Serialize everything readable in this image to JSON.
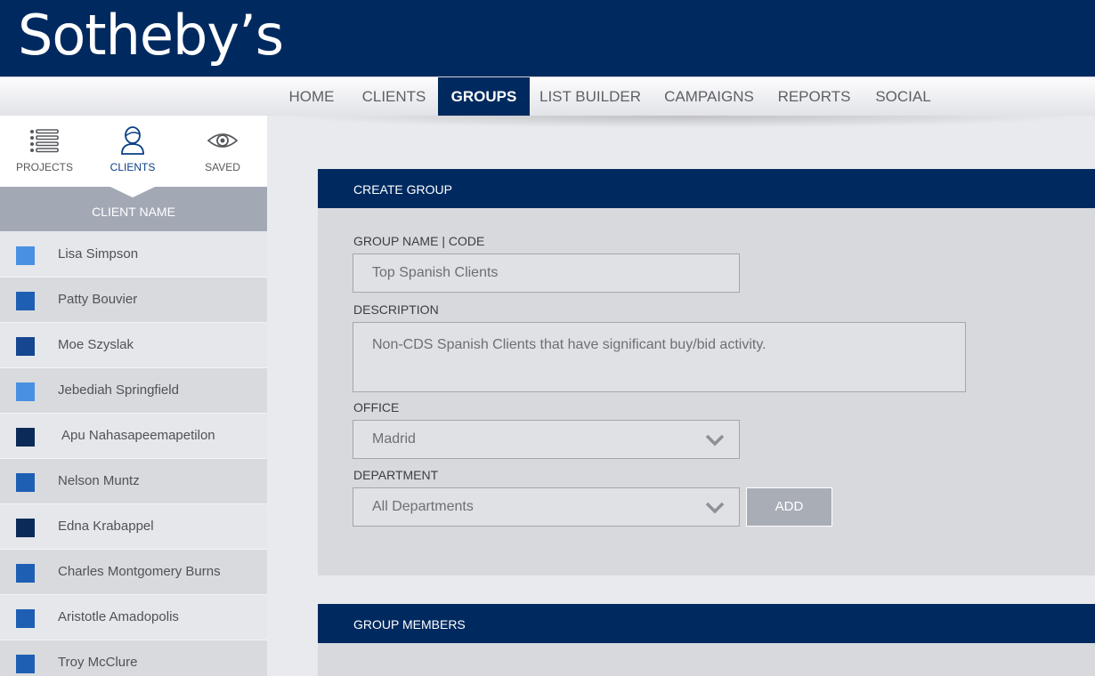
{
  "brand": {
    "logo_text": "Sotheby’s"
  },
  "nav": {
    "items": [
      {
        "label": "HOME"
      },
      {
        "label": "CLIENTS"
      },
      {
        "label": "GROUPS"
      },
      {
        "label": "LIST BUILDER"
      },
      {
        "label": "CAMPAIGNS"
      },
      {
        "label": "REPORTS"
      },
      {
        "label": "SOCIAL"
      }
    ],
    "active": "GROUPS"
  },
  "sidebar": {
    "tabs": [
      {
        "label": "PROJECTS",
        "icon": "list-icon"
      },
      {
        "label": "CLIENTS",
        "icon": "user-icon"
      },
      {
        "label": "SAVED",
        "icon": "eye-icon"
      }
    ],
    "active_tab": "CLIENTS",
    "column_header": "CLIENT NAME",
    "clients": [
      {
        "name": "Lisa Simpson",
        "color": "#4a90e2"
      },
      {
        "name": "Patty Bouvier",
        "color": "#1e5fb3"
      },
      {
        "name": "Moe Szyslak",
        "color": "#16468f"
      },
      {
        "name": "Jebediah Springfield",
        "color": "#4a90e2"
      },
      {
        "name": "Apu Nahasapeemapetilon",
        "color": "#0b2a57"
      },
      {
        "name": "Nelson Muntz",
        "color": "#1e5fb3"
      },
      {
        "name": "Edna Krabappel",
        "color": "#0b2a57"
      },
      {
        "name": "Charles Montgomery Burns",
        "color": "#1e5fb3"
      },
      {
        "name": "Aristotle Amadopolis",
        "color": "#1e5fb3"
      },
      {
        "name": "Troy McClure",
        "color": "#1e5fb3"
      }
    ]
  },
  "create_group": {
    "title": "CREATE GROUP",
    "group_name_label": "GROUP NAME | CODE",
    "group_name_value": "Top Spanish Clients",
    "description_label": "DESCRIPTION",
    "description_value": "Non-CDS Spanish Clients that have significant buy/bid activity.",
    "office_label": "OFFICE",
    "office_value": "Madrid",
    "department_label": "DEPARTMENT",
    "department_value": "All Departments",
    "add_label": "ADD"
  },
  "group_members": {
    "title": "GROUP MEMBERS"
  },
  "colors": {
    "navy": "#002a5f",
    "panel": "#d7d9dd",
    "page": "#e9eaee"
  }
}
